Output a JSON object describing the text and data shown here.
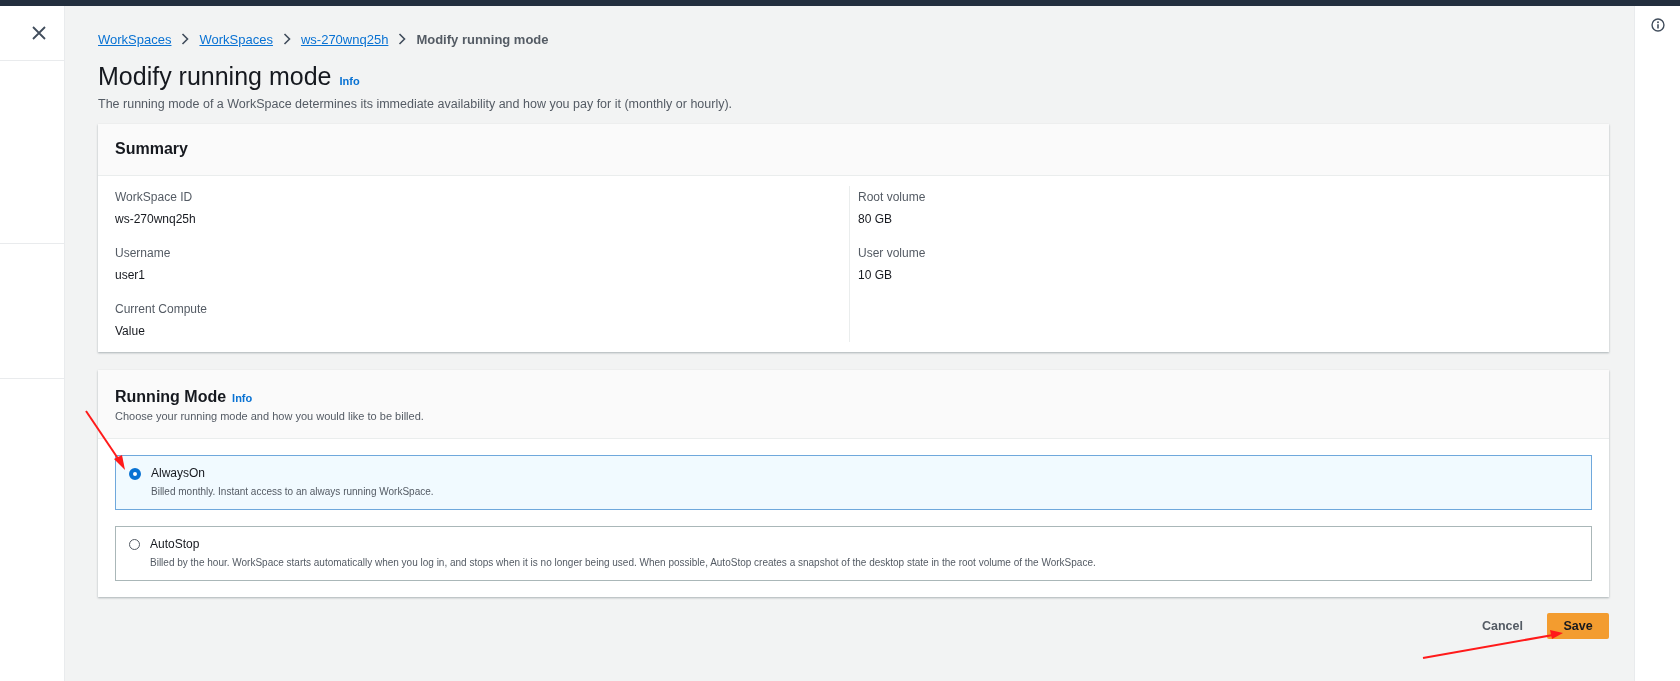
{
  "breadcrumbs": [
    {
      "label": "WorkSpaces",
      "kind": "link"
    },
    {
      "label": "WorkSpaces",
      "kind": "link"
    },
    {
      "label": "ws-270wnq25h",
      "kind": "link"
    },
    {
      "label": "Modify running mode",
      "kind": "current"
    }
  ],
  "page": {
    "title": "Modify running mode",
    "info": "Info",
    "description": "The running mode of a WorkSpace determines its immediate availability and how you pay for it (monthly or hourly)."
  },
  "summary": {
    "title": "Summary",
    "columns": [
      [
        {
          "label": "WorkSpace ID",
          "value": "ws-270wnq25h"
        },
        {
          "label": "Username",
          "value": "user1"
        },
        {
          "label": "Current Compute",
          "value": "Value"
        }
      ],
      [
        {
          "label": "Root volume",
          "value": "80 GB"
        },
        {
          "label": "User volume",
          "value": "10 GB"
        }
      ]
    ]
  },
  "running_mode": {
    "title": "Running Mode",
    "info": "Info",
    "description": "Choose your running mode and how you would like to be billed.",
    "options": [
      {
        "label": "AlwaysOn",
        "description": "Billed monthly. Instant access to an always running WorkSpace.",
        "selected": true
      },
      {
        "label": "AutoStop",
        "description": "Billed by the hour. WorkSpace starts automatically when you log in, and stops when it is no longer being used. When possible, AutoStop creates a snapshot of the desktop state in the root volume of the WorkSpace.",
        "selected": false
      }
    ]
  },
  "buttons": [
    {
      "label": "Cancel",
      "kind": "link"
    },
    {
      "label": "Save",
      "kind": "primary"
    }
  ]
}
